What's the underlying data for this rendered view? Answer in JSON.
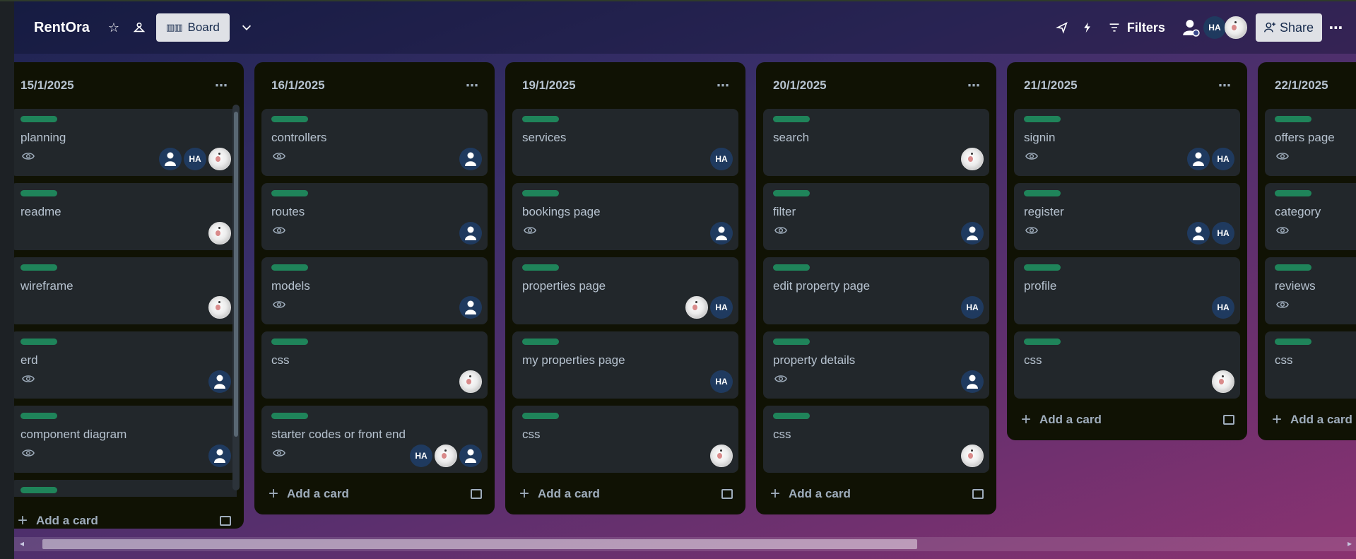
{
  "header": {
    "board_title": "RentOra",
    "view_label": "Board",
    "filters_label": "Filters",
    "share_label": "Share",
    "avatar_ha": "HA"
  },
  "lists": [
    {
      "title": "15/1/2025",
      "add_card_label": "Add a card",
      "cards": [
        {
          "title": "planning"
        },
        {
          "title": "readme"
        },
        {
          "title": "wireframe"
        },
        {
          "title": "erd"
        },
        {
          "title": "component diagram"
        }
      ]
    },
    {
      "title": "16/1/2025",
      "add_card_label": "Add a card",
      "cards": [
        {
          "title": "controllers"
        },
        {
          "title": "routes"
        },
        {
          "title": "models"
        },
        {
          "title": "css"
        },
        {
          "title": "starter codes or front end"
        }
      ]
    },
    {
      "title": "19/1/2025",
      "add_card_label": "Add a card",
      "cards": [
        {
          "title": "services"
        },
        {
          "title": "bookings page"
        },
        {
          "title": "properties page"
        },
        {
          "title": "my properties page"
        },
        {
          "title": "css"
        }
      ]
    },
    {
      "title": "20/1/2025",
      "add_card_label": "Add a card",
      "cards": [
        {
          "title": "search"
        },
        {
          "title": "filter"
        },
        {
          "title": "edit property page"
        },
        {
          "title": "property details"
        },
        {
          "title": "css"
        }
      ]
    },
    {
      "title": "21/1/2025",
      "add_card_label": "Add a card",
      "cards": [
        {
          "title": "signin"
        },
        {
          "title": "register"
        },
        {
          "title": "profile"
        },
        {
          "title": "css"
        }
      ]
    },
    {
      "title": "22/1/2025",
      "add_card_label": "Add a card",
      "cards": [
        {
          "title": "offers page"
        },
        {
          "title": "category"
        },
        {
          "title": "reviews"
        },
        {
          "title": "css"
        }
      ]
    }
  ],
  "member_initials": "HA",
  "colors": {
    "label_green": "#1f845a",
    "list_bg": "#101204",
    "card_bg": "#22272b"
  }
}
